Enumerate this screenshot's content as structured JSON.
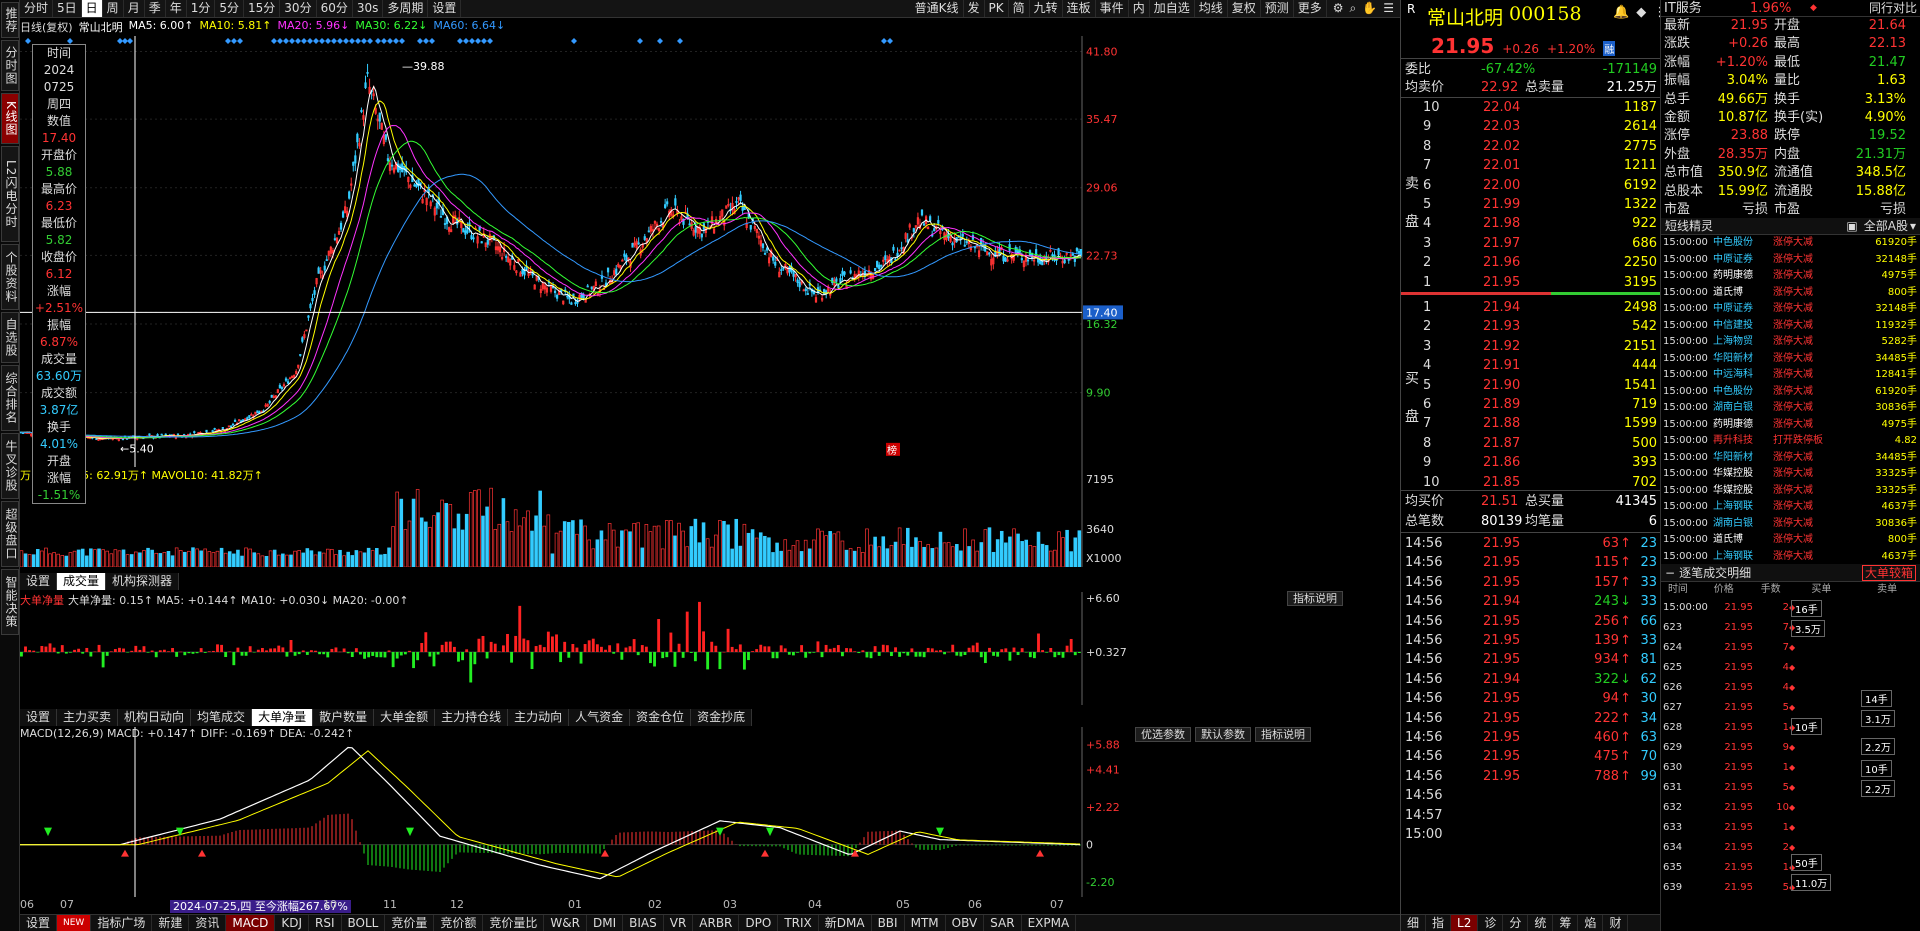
{
  "sidebar": {
    "tabs": [
      "推荐",
      "分时图",
      "K线图",
      "L2闪电分时",
      "个股资料",
      "自选股",
      "综合排名",
      "牛叉诊股",
      "超级盘口",
      "智能决策"
    ],
    "active": 2
  },
  "toolbar": {
    "left": [
      "分时",
      "5日",
      "日",
      "周",
      "月",
      "季",
      "年",
      "1分",
      "5分",
      "15分",
      "30分",
      "60分",
      "30s",
      "多周期",
      "设置"
    ],
    "active": 2,
    "right": [
      "普通K线",
      "发",
      "PK",
      "简",
      "九转",
      "连板",
      "事件",
      "内",
      "加自选",
      "均线",
      "复权",
      "预测",
      "更多"
    ]
  },
  "legend": {
    "title": "日线(复权)",
    "stock": "常山北明",
    "ma5": "MA5: 6.00↑",
    "ma10": "MA10: 5.81↑",
    "ma20": "MA20: 5.96↓",
    "ma30": "MA30: 6.22↓",
    "ma60": "MA60: 6.64↓",
    "colors": {
      "ma5": "#ffffff",
      "ma10": "#ffff00",
      "ma20": "#ff33ff",
      "ma30": "#33ff33",
      "ma60": "#3399ff"
    }
  },
  "infobox": [
    {
      "l": "时间",
      "v": "2024",
      "c": "lbl"
    },
    {
      "l": "",
      "v": "0725",
      "c": "lbl"
    },
    {
      "l": "",
      "v": "周四",
      "c": "lbl"
    },
    {
      "l": "数值",
      "v": "17.40",
      "c": "red"
    },
    {
      "l": "开盘价",
      "v": "5.88",
      "c": "grn"
    },
    {
      "l": "最高价",
      "v": "6.23",
      "c": "red"
    },
    {
      "l": "最低价",
      "v": "5.82",
      "c": "grn"
    },
    {
      "l": "收盘价",
      "v": "6.12",
      "c": "red"
    },
    {
      "l": "涨幅",
      "v": "+2.51%",
      "c": "red"
    },
    {
      "l": "振幅",
      "v": "6.87%",
      "c": "red"
    },
    {
      "l": "成交量",
      "v": "63.60万",
      "c": "cy"
    },
    {
      "l": "成交额",
      "v": "3.87亿",
      "c": "cy"
    },
    {
      "l": "换手",
      "v": "4.01%",
      "c": "cy"
    },
    {
      "l": "开盘",
      "v": "",
      "c": "lbl"
    },
    {
      "l": "涨幅",
      "v": "-1.51%",
      "c": "grn"
    }
  ],
  "main_axis": [
    "41.80",
    "35.47",
    "29.06",
    "22.73",
    "17.40",
    "16.32",
    "9.90"
  ],
  "high_label": "39.88",
  "low_label": "5.40",
  "crosshair_label": "17.40",
  "marker_label": "榜",
  "volume": {
    "legend": "万↑ MAVOL5: 62.91万↑ MAVOL10: 41.82万↑",
    "axis": [
      "7195",
      "3640",
      "X1000"
    ]
  },
  "subtabs1": [
    "设置",
    "成交量",
    "机构探测器"
  ],
  "subtabs1_active": 1,
  "dadan": {
    "legend_title": "大单净量",
    "legend": "大单净量: 0.15↑ MA5: +0.144↑ MA10: +0.030↓ MA20: -0.00↑",
    "axis": [
      "+6.60",
      "+0.327"
    ],
    "help": "指标说明"
  },
  "subtabs2": [
    "设置",
    "主力买卖",
    "机构日动向",
    "均笔成交",
    "大单净量",
    "散户数量",
    "大单金额",
    "主力持仓线",
    "主力动向",
    "人气资金",
    "资金仓位",
    "资金抄底"
  ],
  "subtabs2_active": 4,
  "macd": {
    "legend": "MACD(12,26,9) MACD: +0.147↑ DIFF: -0.169↑ DEA: -0.242↑",
    "axis": [
      "+5.88",
      "+4.41",
      "+2.22",
      "0",
      "-2.20"
    ],
    "buttons": [
      "优选参数",
      "默认参数",
      "指标说明"
    ],
    "note": "2024-07-25,四 至今涨幅267.67%"
  },
  "dates": [
    "06",
    "07",
    "10",
    "11",
    "12",
    "01",
    "02",
    "03",
    "04",
    "05",
    "06",
    "07"
  ],
  "bottombar": [
    "设置",
    "NEW",
    "指标广场",
    "新建",
    "资讯",
    "MACD",
    "KDJ",
    "RSI",
    "BOLL",
    "竞价量",
    "竞价额",
    "竞价量比",
    "W&R",
    "DMI",
    "BIAS",
    "VR",
    "ARBR",
    "DPO",
    "TRIX",
    "新DMA",
    "BBI",
    "MTM",
    "OBV",
    "SAR",
    "EXPMA"
  ],
  "bottombar_active": 5,
  "quote": {
    "name": "常山北明",
    "code": "000158",
    "price": "21.95",
    "change": "+0.26",
    "pct": "+1.20%",
    "badge": "融",
    "weibi_label": "委比",
    "weibi": "-67.42%",
    "weicha": "-171149",
    "avg_sell_label": "均卖价",
    "avg_sell": "22.92",
    "total_sell_label": "总卖量",
    "total_sell": "21.25万",
    "sell_side": "卖盘",
    "buy_side": "买盘",
    "sells": [
      [
        "10",
        "22.04",
        "1187"
      ],
      [
        "9",
        "22.03",
        "2614"
      ],
      [
        "8",
        "22.02",
        "2775"
      ],
      [
        "7",
        "22.01",
        "1211"
      ],
      [
        "6",
        "22.00",
        "6192"
      ],
      [
        "5",
        "21.99",
        "1322"
      ],
      [
        "4",
        "21.98",
        "922"
      ],
      [
        "3",
        "21.97",
        "686"
      ],
      [
        "2",
        "21.96",
        "2250"
      ],
      [
        "1",
        "21.95",
        "3195"
      ]
    ],
    "buys": [
      [
        "1",
        "21.94",
        "2498"
      ],
      [
        "2",
        "21.93",
        "542"
      ],
      [
        "3",
        "21.92",
        "2151"
      ],
      [
        "4",
        "21.91",
        "444"
      ],
      [
        "5",
        "21.90",
        "1541"
      ],
      [
        "6",
        "21.89",
        "719"
      ],
      [
        "7",
        "21.88",
        "1599"
      ],
      [
        "8",
        "21.87",
        "500"
      ],
      [
        "9",
        "21.86",
        "393"
      ],
      [
        "10",
        "21.85",
        "702"
      ]
    ],
    "avg_buy_label": "均买价",
    "avg_buy": "21.51",
    "total_buy_label": "总买量",
    "total_buy": "41345",
    "total_trades_label": "总笔数",
    "total_trades": "80139",
    "avg_trade_label": "均笔量",
    "avg_trade": "6",
    "ticks": [
      [
        "14:56",
        "21.95",
        "63",
        "↑",
        "23"
      ],
      [
        "14:56",
        "21.95",
        "115",
        "↑",
        "23"
      ],
      [
        "14:56",
        "21.95",
        "157",
        "↑",
        "33"
      ],
      [
        "14:56",
        "21.94",
        "243",
        "↓",
        "33"
      ],
      [
        "14:56",
        "21.95",
        "256",
        "↑",
        "66"
      ],
      [
        "14:56",
        "21.95",
        "139",
        "↑",
        "33"
      ],
      [
        "14:56",
        "21.95",
        "934",
        "↑",
        "81"
      ],
      [
        "14:56",
        "21.94",
        "322",
        "↓",
        "62"
      ],
      [
        "14:56",
        "21.95",
        "94",
        "↑",
        "30"
      ],
      [
        "14:56",
        "21.95",
        "222",
        "↑",
        "34"
      ],
      [
        "14:56",
        "21.95",
        "460",
        "↑",
        "63"
      ],
      [
        "14:56",
        "21.95",
        "475",
        "↑",
        "70"
      ],
      [
        "14:56",
        "21.95",
        "788",
        "↑",
        "99"
      ],
      [
        "14:56",
        "",
        "",
        "",
        ""
      ],
      [
        "14:57",
        "",
        "",
        "",
        ""
      ],
      [
        "15:00",
        "",
        "",
        "",
        ""
      ]
    ],
    "tabs": [
      "细",
      "指",
      "L2",
      "诊",
      "分",
      "统",
      "筹",
      "焰",
      "财"
    ],
    "tab_active": 2
  },
  "stats": {
    "sector": "IT服务",
    "sector_pct": "1.96%",
    "sector_btn": "同行对比",
    "rows": [
      [
        "最新",
        "21.95",
        "开盘",
        "21.64"
      ],
      [
        "涨跌",
        "+0.26",
        "最高",
        "22.13"
      ],
      [
        "涨幅",
        "+1.20%",
        "最低",
        "21.47"
      ],
      [
        "振幅",
        "3.04%",
        "量比",
        "1.63"
      ],
      [
        "总手",
        "49.66万",
        "换手",
        "3.13%"
      ],
      [
        "金额",
        "10.87亿",
        "换手(实)",
        "4.90%"
      ],
      [
        "涨停",
        "23.88",
        "跌停",
        "19.52"
      ],
      [
        "外盘",
        "28.35万",
        "内盘",
        "21.31万"
      ],
      [
        "总市值",
        "350.9亿",
        "流通值",
        "348.5亿"
      ],
      [
        "总股本",
        "15.99亿",
        "流通股",
        "15.88亿"
      ],
      [
        "市盈(静)",
        "亏损",
        "市盈(TTM)",
        "亏损"
      ]
    ]
  },
  "sector_news": {
    "title": "短线精灵",
    "filter": "全部A股",
    "rows": [
      [
        "15:00:00",
        "中色股份",
        "涨停大减",
        "61920手"
      ],
      [
        "15:00:00",
        "中原证券",
        "涨停大减",
        "32148手"
      ],
      [
        "15:00:00",
        "药明康德",
        "涨停大减",
        "4975手"
      ],
      [
        "15:00:00",
        "道氏博",
        "涨停大减",
        "800手"
      ],
      [
        "15:00:00",
        "中原证券",
        "涨停大减",
        "32148手"
      ],
      [
        "15:00:00",
        "中信建投",
        "涨停大减",
        "11932手"
      ],
      [
        "15:00:00",
        "上海物贸",
        "涨停大减",
        "5282手"
      ],
      [
        "15:00:00",
        "华阳新材",
        "涨停大减",
        "34485手"
      ],
      [
        "15:00:00",
        "中远海科",
        "涨停大减",
        "12841手"
      ],
      [
        "15:00:00",
        "中色股份",
        "涨停大减",
        "61920手"
      ],
      [
        "15:00:00",
        "湖南白银",
        "涨停大减",
        "30836手"
      ],
      [
        "15:00:00",
        "药明康德",
        "涨停大减",
        "4975手"
      ],
      [
        "15:00:00",
        "再升科技",
        "打开跌停板",
        "4.82"
      ],
      [
        "15:00:00",
        "华阳新材",
        "涨停大减",
        "34485手"
      ],
      [
        "15:00:00",
        "华媒控股",
        "涨停大减",
        "33325手"
      ],
      [
        "15:00:00",
        "华媒控股",
        "涨停大减",
        "33325手"
      ],
      [
        "15:00:00",
        "上海钢联",
        "涨停大减",
        "4637手"
      ],
      [
        "15:00:00",
        "湖南白银",
        "涨停大减",
        "30836手"
      ],
      [
        "15:00:00",
        "道氏博",
        "涨停大减",
        "800手"
      ],
      [
        "15:00:00",
        "上海钢联",
        "涨停大减",
        "4637手"
      ]
    ]
  },
  "trade_detail": {
    "title": "逐笔成交明细",
    "btn": "大单较箱",
    "headers": [
      "时间",
      "价格",
      "手数",
      "买单",
      "卖单"
    ],
    "rows": [
      [
        "15:00:00",
        "21.95",
        "2",
        "",
        ""
      ],
      [
        "623",
        "21.95",
        "7",
        "",
        ""
      ],
      [
        "624",
        "21.95",
        "7",
        "",
        ""
      ],
      [
        "625",
        "21.95",
        "4",
        "",
        ""
      ],
      [
        "626",
        "21.95",
        "4",
        "",
        ""
      ],
      [
        "627",
        "21.95",
        "5",
        "",
        ""
      ],
      [
        "628",
        "21.95",
        "1",
        "",
        ""
      ],
      [
        "629",
        "21.95",
        "9",
        "",
        ""
      ],
      [
        "630",
        "21.95",
        "1",
        "",
        ""
      ],
      [
        "631",
        "21.95",
        "5",
        "",
        ""
      ],
      [
        "632",
        "21.95",
        "10",
        "",
        ""
      ],
      [
        "633",
        "21.95",
        "1",
        "",
        ""
      ],
      [
        "634",
        "21.95",
        "2",
        "",
        ""
      ],
      [
        "635",
        "21.95",
        "1",
        "",
        ""
      ],
      [
        "639",
        "21.95",
        "5",
        "",
        ""
      ]
    ],
    "boxes": [
      "16手",
      "3.5万",
      "14手",
      "3.1万",
      "10手",
      "2.2万",
      "10手",
      "2.2万",
      "50手",
      "11.0万"
    ]
  }
}
